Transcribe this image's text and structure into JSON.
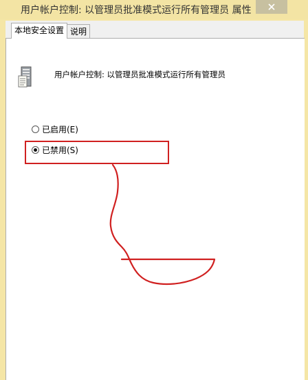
{
  "window": {
    "title": "用户帐户控制: 以管理员批准模式运行所有管理员 属性"
  },
  "tabs": [
    {
      "label": "本地安全设置",
      "active": true
    },
    {
      "label": "说明",
      "active": false
    }
  ],
  "policy": {
    "name": "用户帐户控制: 以管理员批准模式运行所有管理员",
    "icon": "server-policy-icon"
  },
  "options": [
    {
      "label": "已启用(E)",
      "checked": false
    },
    {
      "label": "已禁用(S)",
      "checked": true
    }
  ],
  "colors": {
    "titlebar": "#f3e4a4",
    "annotation": "#d02020"
  }
}
